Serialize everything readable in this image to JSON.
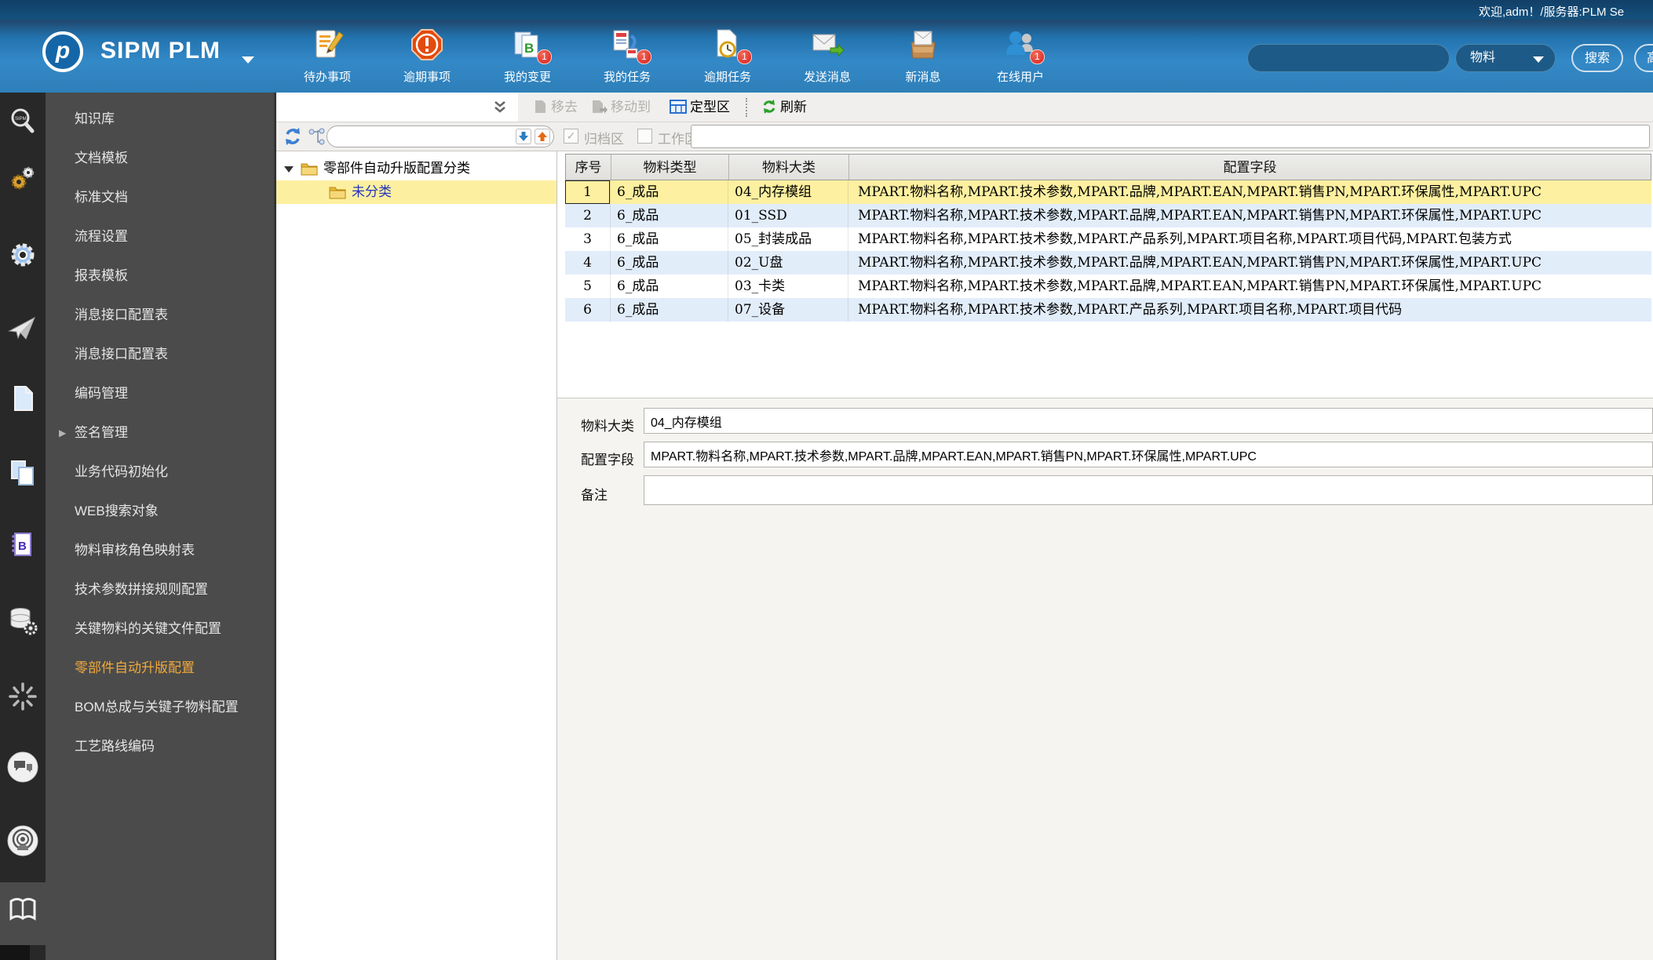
{
  "header": {
    "logo": "SIPM PLM",
    "welcome": "欢迎,adm！/服务器:PLM Se",
    "items": [
      {
        "label": "待办事项",
        "badge": ""
      },
      {
        "label": "逾期事项",
        "badge": ""
      },
      {
        "label": "我的变更",
        "badge": "1"
      },
      {
        "label": "我的任务",
        "badge": "1"
      },
      {
        "label": "逾期任务",
        "badge": "1"
      },
      {
        "label": "发送消息",
        "badge": ""
      },
      {
        "label": "新消息",
        "badge": ""
      },
      {
        "label": "在线用户",
        "badge": "1"
      }
    ],
    "search": {
      "value": "",
      "category": "物料",
      "search_label": "搜索",
      "advanced_label": "高"
    }
  },
  "sidebar": {
    "items": [
      {
        "label": "知识库"
      },
      {
        "label": "文档模板"
      },
      {
        "label": "标准文档"
      },
      {
        "label": "流程设置"
      },
      {
        "label": "报表模板"
      },
      {
        "label": "消息接口配置表"
      },
      {
        "label": "消息接口配置表"
      },
      {
        "label": "编码管理"
      },
      {
        "label": "签名管理"
      },
      {
        "label": "业务代码初始化"
      },
      {
        "label": "WEB搜索对象"
      },
      {
        "label": "物料审核角色映射表"
      },
      {
        "label": "技术参数拼接规则配置"
      },
      {
        "label": "关键物料的关键文件配置"
      },
      {
        "label": "零部件自动升版配置"
      },
      {
        "label": "BOM总成与关键子物料配置"
      },
      {
        "label": "工艺路线编码"
      }
    ]
  },
  "toolbar": {
    "remove": "移去",
    "move_to": "移动到",
    "fixed_zone": "定型区",
    "refresh": "刷新"
  },
  "filterbar": {
    "archive": "归档区",
    "work": "工作区",
    "tree_search_value": "",
    "list_filter_value": ""
  },
  "tree": {
    "root": "零部件自动升版配置分类",
    "child": "未分类"
  },
  "table": {
    "columns": [
      "序号",
      "物料类型",
      "物料大类",
      "配置字段"
    ],
    "rows": [
      {
        "seq": "1",
        "type": "6_成品",
        "category": "04_内存模组",
        "fields": "MPART.物料名称,MPART.技术参数,MPART.品牌,MPART.EAN,MPART.销售PN,MPART.环保属性,MPART.UPC"
      },
      {
        "seq": "2",
        "type": "6_成品",
        "category": "01_SSD",
        "fields": "MPART.物料名称,MPART.技术参数,MPART.品牌,MPART.EAN,MPART.销售PN,MPART.环保属性,MPART.UPC"
      },
      {
        "seq": "3",
        "type": "6_成品",
        "category": "05_封装成品",
        "fields": "MPART.物料名称,MPART.技术参数,MPART.产品系列,MPART.项目名称,MPART.项目代码,MPART.包装方式"
      },
      {
        "seq": "4",
        "type": "6_成品",
        "category": "02_U盘",
        "fields": "MPART.物料名称,MPART.技术参数,MPART.品牌,MPART.EAN,MPART.销售PN,MPART.环保属性,MPART.UPC"
      },
      {
        "seq": "5",
        "type": "6_成品",
        "category": "03_卡类",
        "fields": "MPART.物料名称,MPART.技术参数,MPART.品牌,MPART.EAN,MPART.销售PN,MPART.环保属性,MPART.UPC"
      },
      {
        "seq": "6",
        "type": "6_成品",
        "category": "07_设备",
        "fields": "MPART.物料名称,MPART.技术参数,MPART.产品系列,MPART.项目名称,MPART.项目代码"
      }
    ]
  },
  "form": {
    "category_label": "物料大类",
    "category_value": "04_内存模组",
    "fields_label": "配置字段",
    "fields_value": "MPART.物料名称,MPART.技术参数,MPART.品牌,MPART.EAN,MPART.销售PN,MPART.环保属性,MPART.UPC",
    "remark_label": "备注",
    "remark_value": ""
  },
  "colors": {
    "accent_orange": "#f0a93c",
    "selected_row": "#fdf0a0",
    "alt_row": "#e2edfa",
    "header_blue": "#3389c7"
  }
}
